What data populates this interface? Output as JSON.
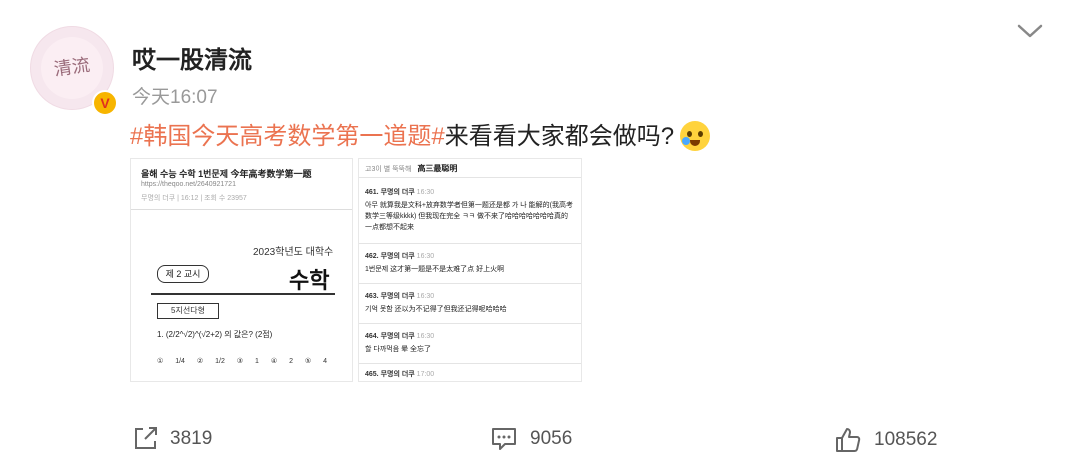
{
  "post": {
    "username": "哎一股清流",
    "time": "今天16:07",
    "avatar_text": "清流",
    "verified_badge": "V",
    "hashtag": "#韩国今天高考数学第一道题#",
    "text": "来看看大家都会做吗?",
    "emoji": "crying-laughing-emoji"
  },
  "images": {
    "left": {
      "title": "올해 수능 수학 1번문제  今年高考数学第一题",
      "url": "https://theqoo.net/2640921721",
      "meta": "무명의 더쿠 | 16:12 | 조회 수 23957",
      "year": "2023학년도 대학수",
      "session": "제 2 교시",
      "subject": "수학",
      "type": "5지선다형",
      "question": "1. (2/2^√2)^(√2+2) 의 값은? (2점)",
      "choices": "① 1/4  ② 1/2  ③ 1  ④ 2  ⑤ 4"
    },
    "right": {
      "header_kr": "고3이 별 뚝뚝해",
      "header_cn": "高三最聪明",
      "comments": [
        {
          "id": "461. 무명의 더쿠",
          "time": "16:30",
          "body": "아무 就算我是文科+放弃数学者但第一题还是都 가 나 能解的(我高考数学三等级kkkk) 但我现在完全 ㅋㅋ 做不来了哈哈哈哈哈哈哈真的一点都想不起来"
        },
        {
          "id": "462. 무명의 더쿠",
          "time": "16:30",
          "body": "1번문제 这才第一题是不是太难了点 好上火啊"
        },
        {
          "id": "463. 무명의 더쿠",
          "time": "16:30",
          "body": "기억 못함 还以为不记得了但我还记得呢哈哈哈"
        },
        {
          "id": "464. 무명의 더쿠",
          "time": "16:30",
          "body": "할 다까먹음   晕 全忘了"
        },
        {
          "id": "465. 무명의 더쿠",
          "time": "17:00",
          "body": ""
        }
      ]
    }
  },
  "footer": {
    "repost_count": "3819",
    "comment_count": "9056",
    "like_count": "108562"
  }
}
